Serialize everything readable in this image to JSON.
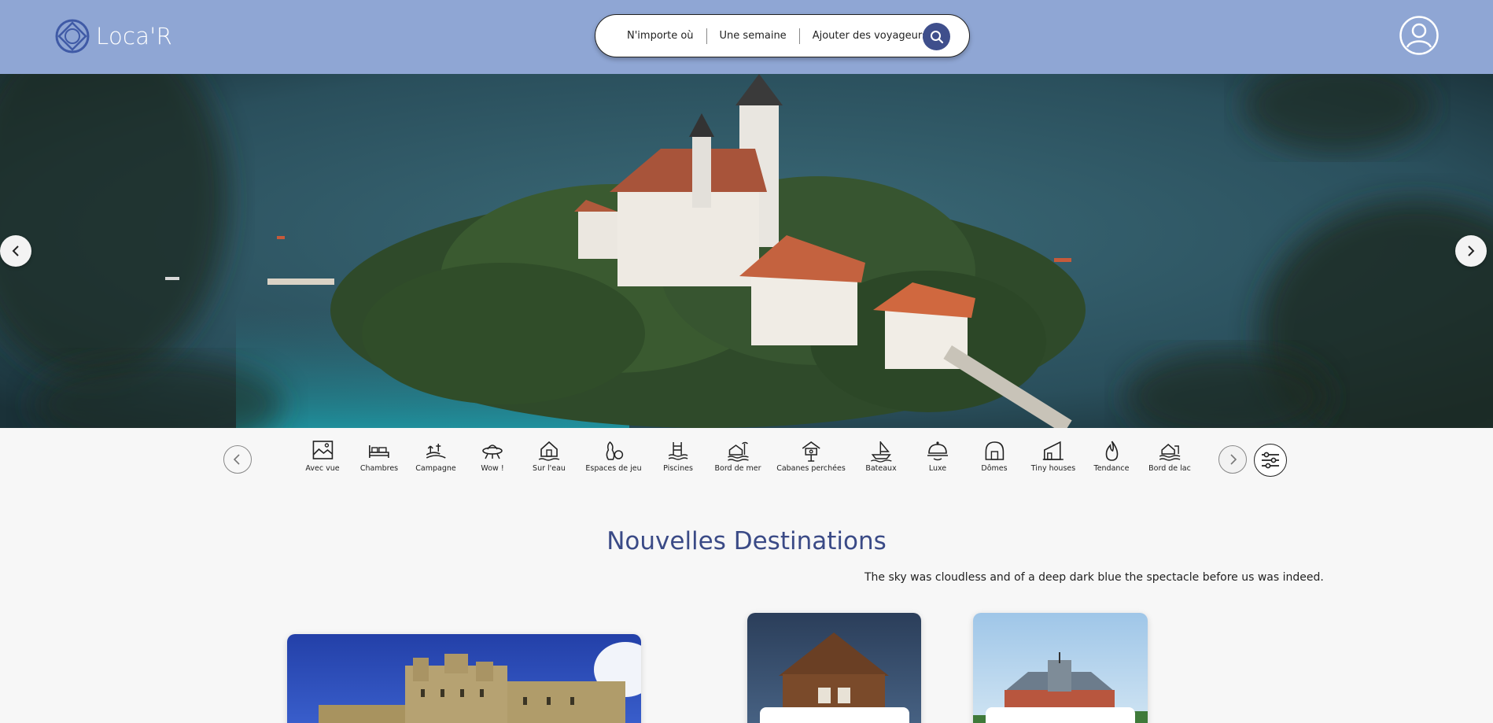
{
  "header": {
    "logo_text": "Loca'R",
    "search": {
      "where": "N'importe où",
      "when": "Une semaine",
      "who": "Ajouter des voyageurs"
    }
  },
  "categories": [
    {
      "label": "Avec vue",
      "icon": "landscape-frame-icon"
    },
    {
      "label": "Chambres",
      "icon": "bed-icon"
    },
    {
      "label": "Campagne",
      "icon": "countryside-icon"
    },
    {
      "label": "Wow !",
      "icon": "ufo-icon"
    },
    {
      "label": "Sur l'eau",
      "icon": "house-on-water-icon"
    },
    {
      "label": "Espaces de jeu",
      "icon": "bowling-icon"
    },
    {
      "label": "Piscines",
      "icon": "pool-icon"
    },
    {
      "label": "Bord de mer",
      "icon": "beach-house-icon"
    },
    {
      "label": "Cabanes perchées",
      "icon": "treehouse-icon"
    },
    {
      "label": "Bateaux",
      "icon": "boat-icon"
    },
    {
      "label": "Luxe",
      "icon": "cloche-icon"
    },
    {
      "label": "Dômes",
      "icon": "dome-icon"
    },
    {
      "label": "Tiny houses",
      "icon": "tiny-house-icon"
    },
    {
      "label": "Tendance",
      "icon": "flame-icon"
    },
    {
      "label": "Bord de lac",
      "icon": "lake-house-icon"
    }
  ],
  "section": {
    "title": "Nouvelles Destinations",
    "subtitle": "The sky was cloudless and of a deep dark blue the spectacle before us was indeed."
  },
  "colors": {
    "header_bg": "#8fa6d4",
    "accent": "#3f4f8c",
    "title": "#3a4a86"
  }
}
